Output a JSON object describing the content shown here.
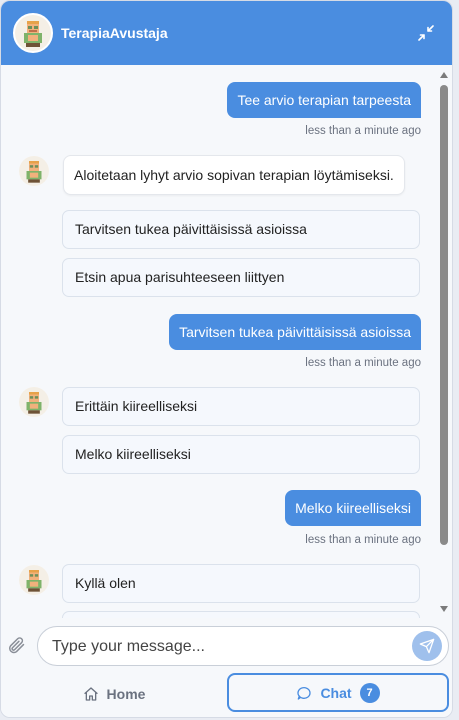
{
  "header": {
    "title": "TerapiaAvustaja",
    "avatar_icon": "bot-avatar-icon",
    "minimize_icon": "minimize-icon",
    "color": "#4a8de0"
  },
  "messages": {
    "user_1": {
      "text": "Tee arvio terapian tarpeesta",
      "time": "less than a minute ago"
    },
    "bot_1": {
      "text": "Aloitetaan lyhyt arvio sopivan terapian löytämiseksi."
    },
    "options_1": [
      "Tarvitsen tukea päivittäisissä asioissa",
      "Etsin apua parisuhteeseen liittyen"
    ],
    "user_2": {
      "text": "Tarvitsen tukea päivittäisissä asioissa",
      "time": "less than a minute ago"
    },
    "options_2": [
      "Erittäin kiireelliseksi",
      "Melko kiireelliseksi"
    ],
    "user_3": {
      "text": "Melko kiireelliseksi",
      "time": "less than a minute ago"
    },
    "options_3": [
      "Kyllä olen"
    ]
  },
  "composer": {
    "placeholder": "Type your message...",
    "attach_icon": "paperclip-icon",
    "send_icon": "send-icon"
  },
  "tabs": {
    "home_label": "Home",
    "chat_label": "Chat",
    "chat_badge": "7"
  }
}
